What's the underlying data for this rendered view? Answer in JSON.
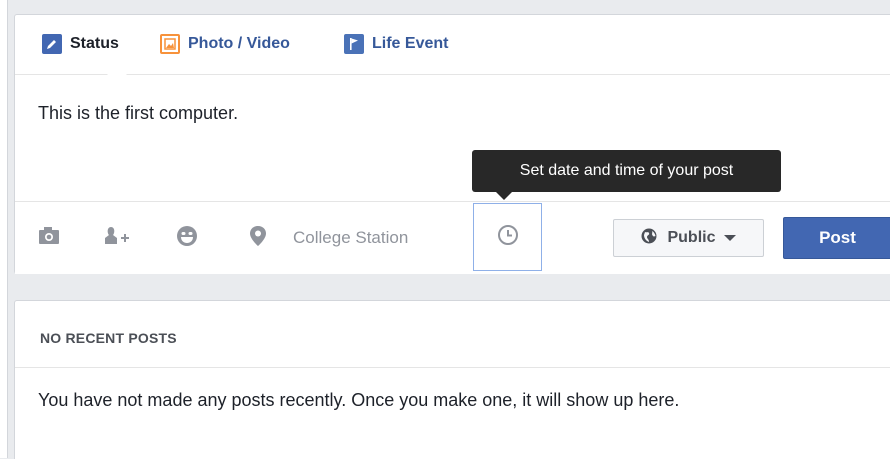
{
  "composer": {
    "tabs": [
      {
        "label": "Status",
        "icon": "pencil-icon"
      },
      {
        "label": "Photo / Video",
        "icon": "photo-icon"
      },
      {
        "label": "Life Event",
        "icon": "flag-icon"
      }
    ],
    "post_text": "This is the first computer.",
    "toolbar": {
      "icons": [
        "camera-icon",
        "tag-friends-icon",
        "feeling-icon",
        "location-pin-icon"
      ],
      "location": "College Station",
      "schedule_icon": "clock-icon",
      "audience_label": "Public",
      "post_label": "Post"
    },
    "tooltip": "Set date and time of your post"
  },
  "recent": {
    "title": "NO RECENT POSTS",
    "body": "You have not made any posts recently. Once you make one, it will show up here."
  },
  "colors": {
    "accent": "#4267b2",
    "link": "#365899",
    "photo_accent": "#f7923b",
    "muted": "#90949c",
    "focus_border": "#8fb0e8"
  }
}
